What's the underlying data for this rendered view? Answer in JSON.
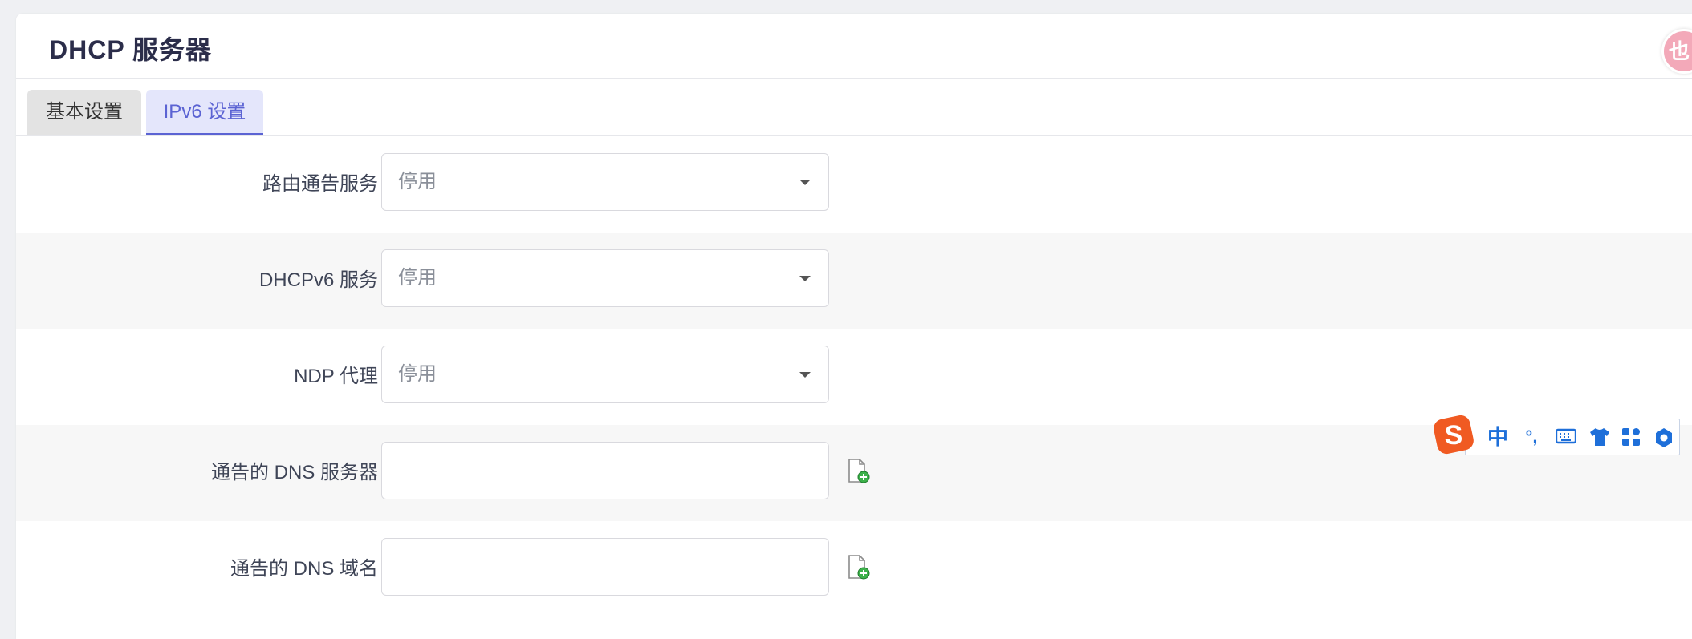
{
  "header": {
    "title": "DHCP 服务器",
    "avatar_glyph": "也"
  },
  "tabs": [
    {
      "label": "基本设置",
      "active": false
    },
    {
      "label": "IPv6 设置",
      "active": true
    }
  ],
  "form": {
    "rows": [
      {
        "label": "路由通告服务",
        "type": "select",
        "value": "停用"
      },
      {
        "label": "DHCPv6 服务",
        "type": "select",
        "value": "停用"
      },
      {
        "label": "NDP 代理",
        "type": "select",
        "value": "停用"
      },
      {
        "label": "通告的 DNS 服务器",
        "type": "input",
        "value": "",
        "add_icon": "add-file-icon"
      },
      {
        "label": "通告的 DNS 域名",
        "type": "input",
        "value": "",
        "add_icon": "add-file-icon"
      }
    ]
  },
  "ime_toolbar": {
    "logo": "S",
    "items": [
      "中",
      "°,",
      "keyboard-icon",
      "shirt-icon",
      "grid-icon",
      "settings-icon"
    ]
  },
  "colors": {
    "accent": "#5b63d3",
    "title": "#2b2d4a",
    "ime_blue": "#1e6fd9",
    "ime_orange": "#f05a22"
  }
}
